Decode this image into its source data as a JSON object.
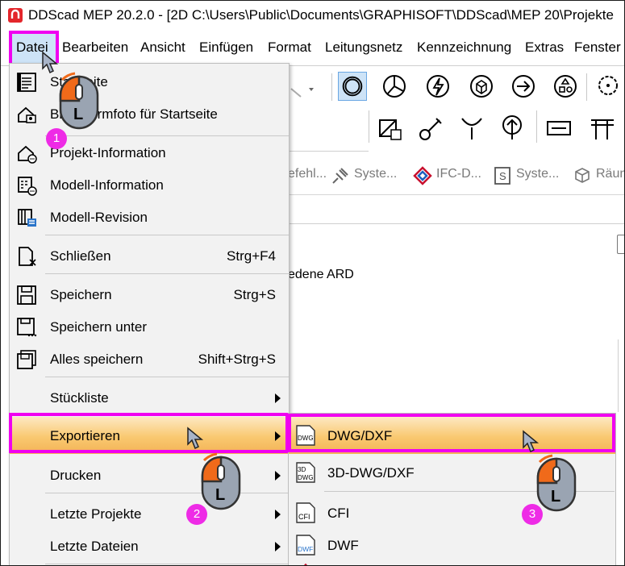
{
  "window": {
    "title": "DDScad MEP 20.2.0 - [2D  C:\\Users\\Public\\Documents\\GRAPHISOFT\\DDScad\\MEP 20\\Projekte"
  },
  "menubar": [
    "Datei",
    "Bearbeiten",
    "Ansicht",
    "Einfügen",
    "Format",
    "Leitungsnetz",
    "Kennzeichnung",
    "Extras",
    "Fenster"
  ],
  "tabs": [
    "efehl...",
    "Syste...",
    "IFC-D...",
    "Syste...",
    "Räun"
  ],
  "background_text": "edene ARD",
  "file_menu": {
    "items": [
      {
        "label": "Startseite",
        "shortcut": ""
      },
      {
        "label": "Bildschirmfoto für Startseite",
        "shortcut": ""
      },
      {
        "label": "Projekt-Information",
        "shortcut": ""
      },
      {
        "label": "Modell-Information",
        "shortcut": ""
      },
      {
        "label": "Modell-Revision",
        "shortcut": ""
      },
      {
        "label": "Schließen",
        "shortcut": "Strg+F4"
      },
      {
        "label": "Speichern",
        "shortcut": "Strg+S"
      },
      {
        "label": "Speichern unter",
        "shortcut": ""
      },
      {
        "label": "Alles speichern",
        "shortcut": "Shift+Strg+S"
      },
      {
        "label": "Stückliste",
        "shortcut": ""
      },
      {
        "label": "Exportieren",
        "shortcut": ""
      },
      {
        "label": "Drucken",
        "shortcut": ""
      },
      {
        "label": "Letzte Projekte",
        "shortcut": ""
      },
      {
        "label": "Letzte Dateien",
        "shortcut": ""
      }
    ]
  },
  "export_submenu": {
    "items": [
      {
        "label": "DWG/DXF",
        "icon_text": "DWG"
      },
      {
        "label": "3D-DWG/DXF",
        "icon_text": "3D DWG"
      },
      {
        "label": "CFI",
        "icon_text": "CFI"
      },
      {
        "label": "DWF",
        "icon_text": "DWF"
      }
    ]
  },
  "annotations": {
    "mouse_letter": "L",
    "badges": [
      "1",
      "2",
      "3"
    ]
  },
  "colors": {
    "highlight": "#f000f0",
    "menu_hover": "#f9c870",
    "badge": "#ee2be6",
    "mouse_orange": "#f06a1a"
  }
}
